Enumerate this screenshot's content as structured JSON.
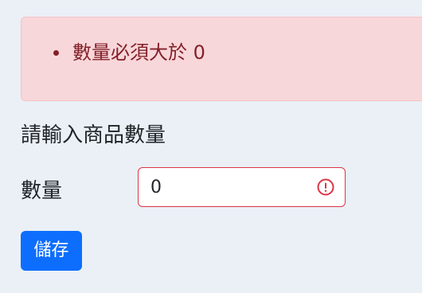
{
  "alert": {
    "errors": [
      "數量必須大於 0"
    ]
  },
  "form": {
    "heading": "請輸入商品數量",
    "quantity_label": "數量",
    "quantity_value": "0",
    "save_label": "儲存"
  },
  "colors": {
    "background": "#eaf0f6",
    "alert_background": "#f8d7da",
    "alert_text": "#842029",
    "invalid_border": "#dc3545",
    "primary_button": "#0d6efd"
  },
  "icons": {
    "invalid": "exclamation-circle-icon"
  }
}
